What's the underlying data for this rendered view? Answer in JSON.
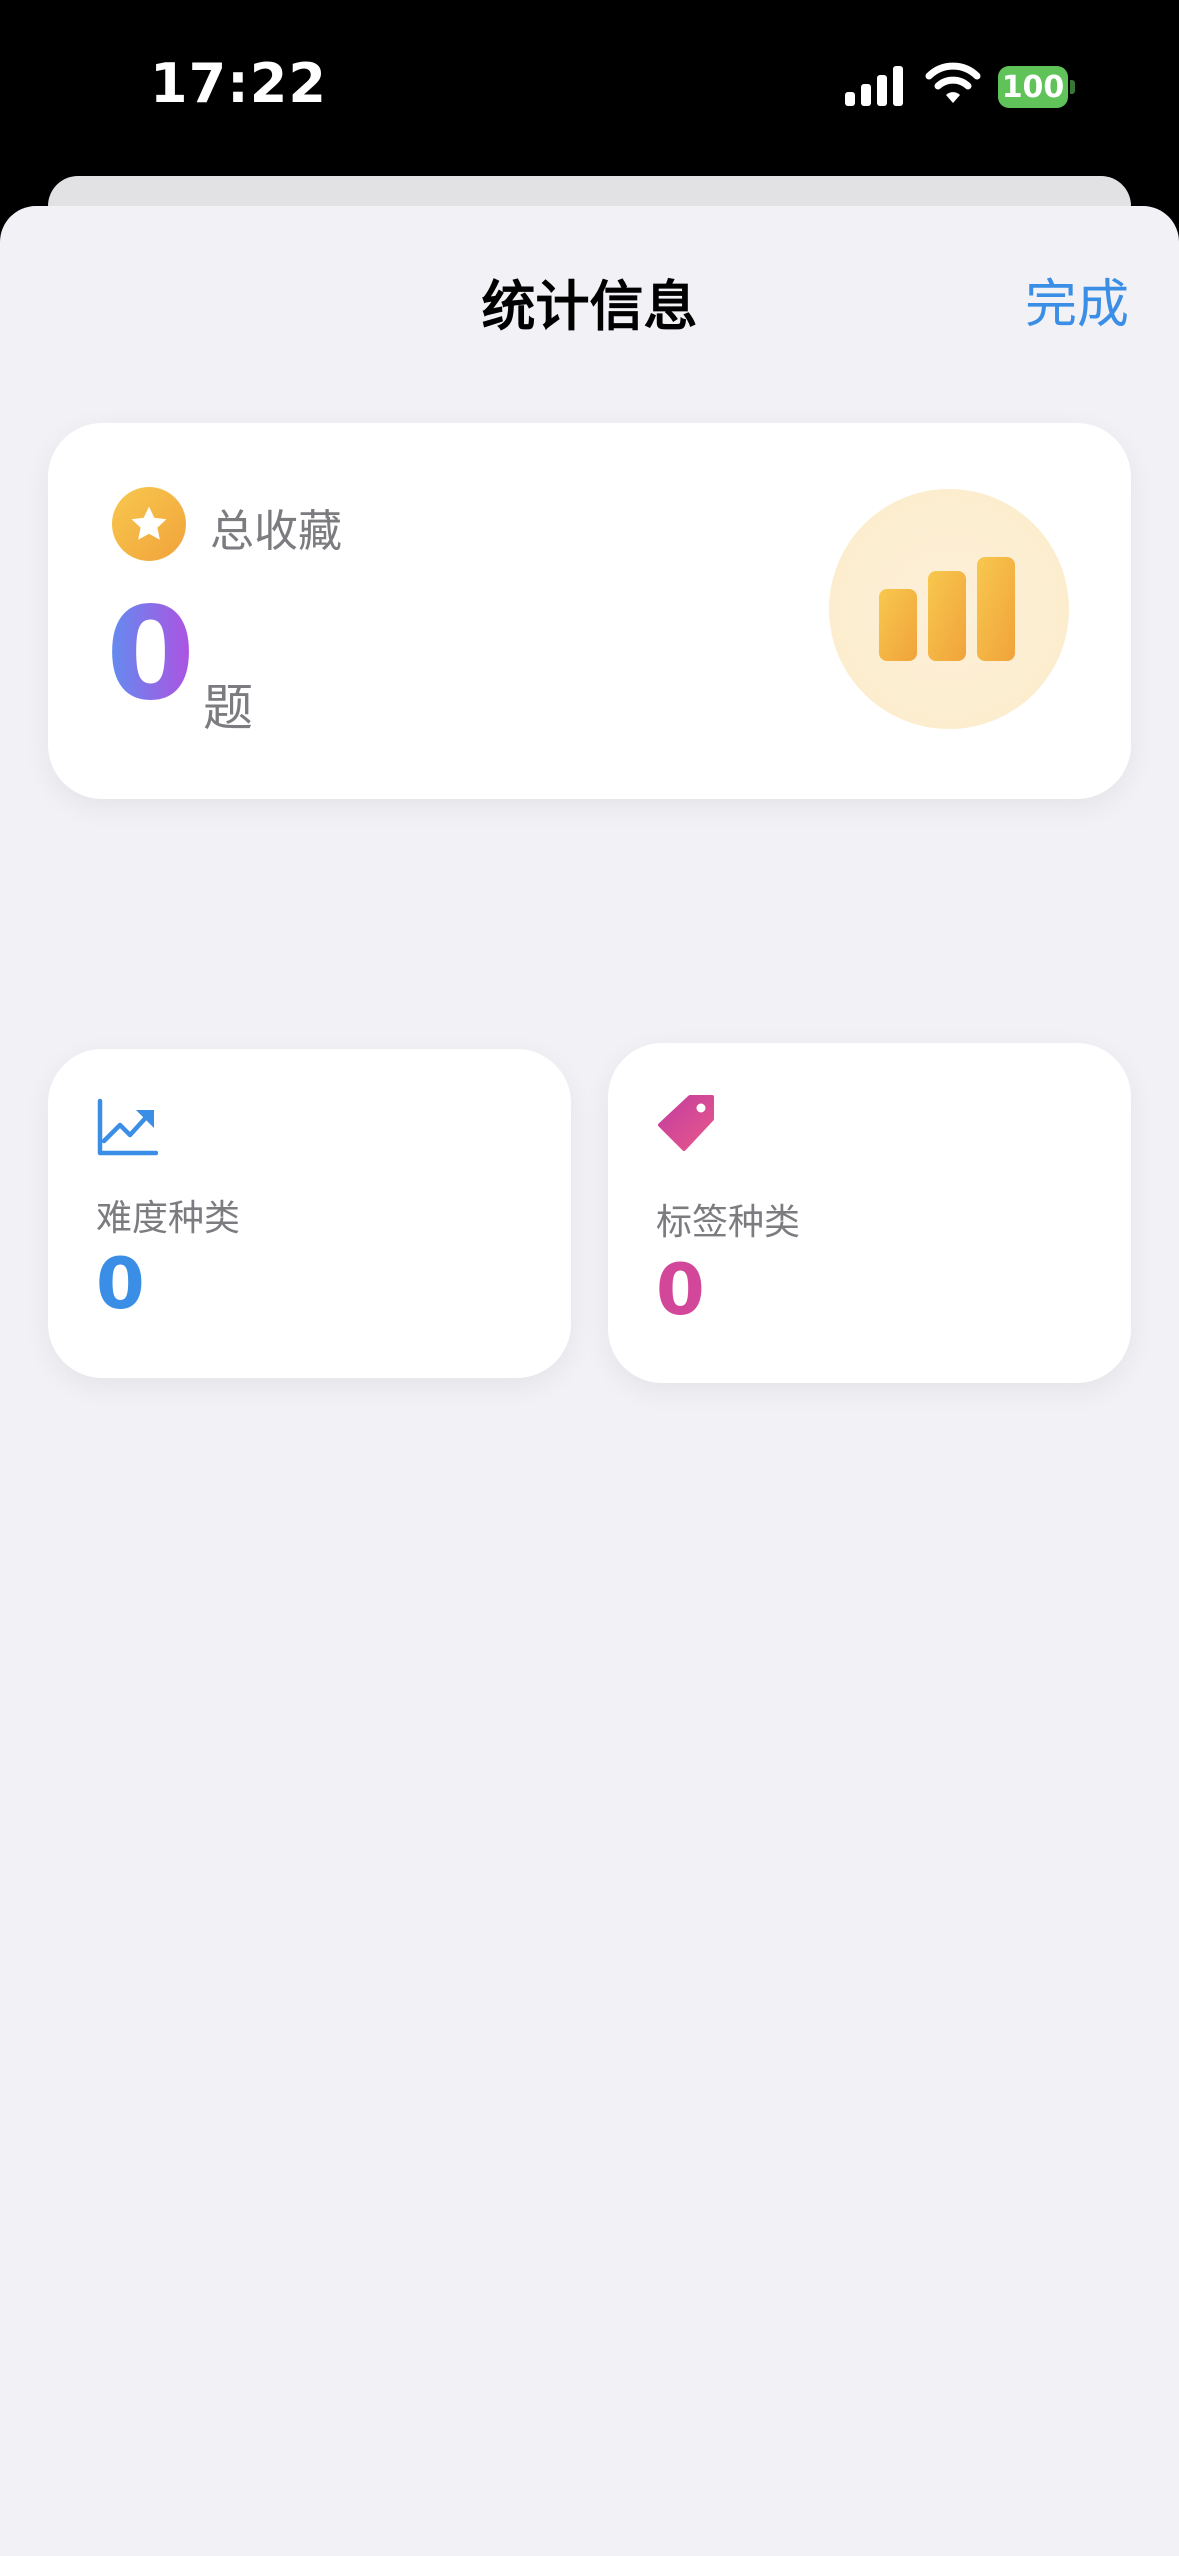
{
  "status_bar": {
    "time": "17:22",
    "battery_level": "100",
    "icons": [
      "signal-icon",
      "wifi-icon",
      "battery-icon"
    ]
  },
  "header": {
    "title": "统计信息",
    "done_label": "完成"
  },
  "total_card": {
    "label": "总收藏",
    "value": "0",
    "unit": "题",
    "icons": [
      "star-icon",
      "bar-chart-icon"
    ],
    "value_gradient": [
      "#5f8ef0",
      "#b150e0"
    ]
  },
  "stats": [
    {
      "label": "难度种类",
      "value": "0",
      "icon": "trending-chart-icon",
      "color": "#3a8ee6"
    },
    {
      "label": "标签种类",
      "value": "0",
      "icon": "tag-icon",
      "color": "#d2479a"
    }
  ],
  "colors": {
    "accent": "#3a8ee6",
    "sheet_background": "#f1f1f6",
    "star_badge": "#f0a33a"
  }
}
